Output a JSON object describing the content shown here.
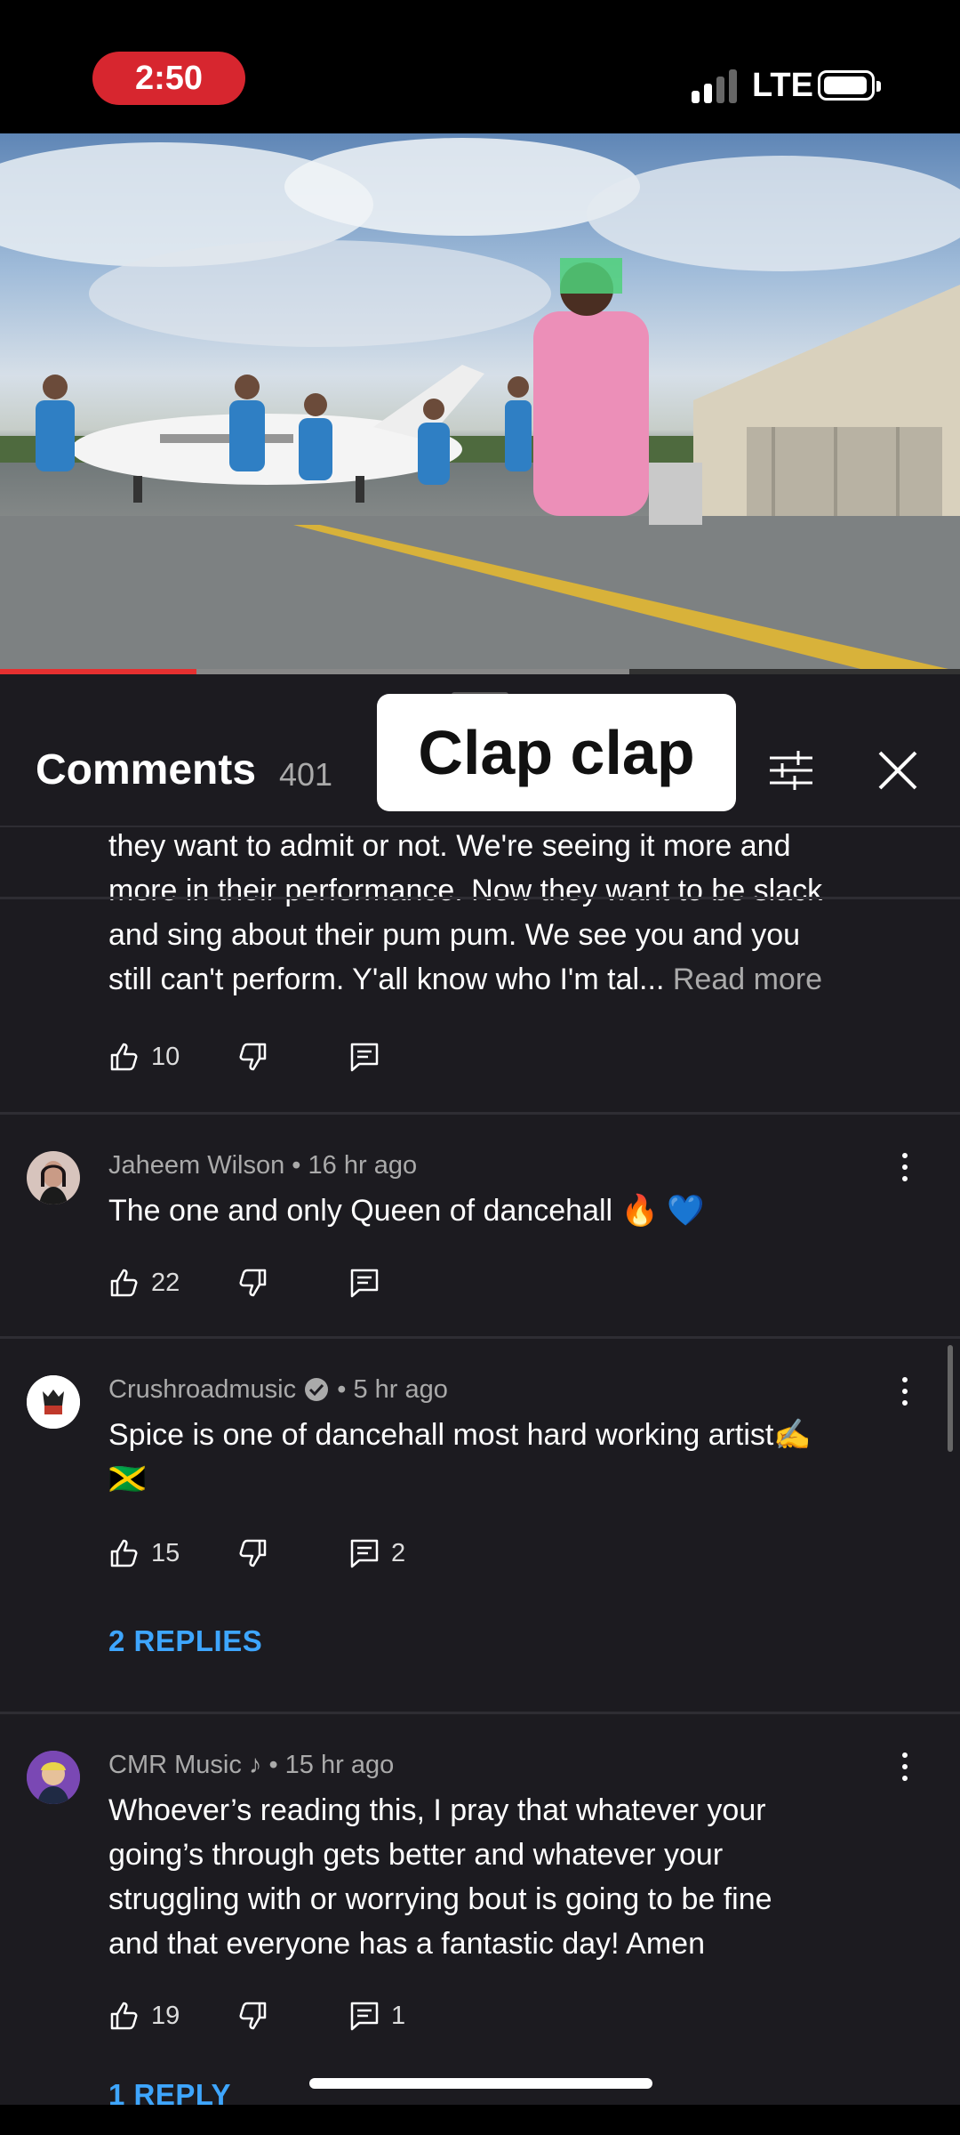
{
  "status": {
    "time": "2:50",
    "network": "LTE"
  },
  "video": {
    "played_fraction": 0.205,
    "buffered_fraction": 0.656
  },
  "panel": {
    "title": "Comments",
    "count": "401",
    "caption": "Clap clap"
  },
  "comments": [
    {
      "text_lines": [
        "they want to admit or not. We're seeing it more and",
        "more in their performance. Now they want to be slack",
        "and sing about their pum pum. We see you and you",
        "still can't perform. Y'all know who I'm tal..."
      ],
      "read_more": "Read more",
      "likes": "10"
    },
    {
      "author": "Jaheem Wilson",
      "age": "16 hr ago",
      "text": "The one and only Queen of dancehall 🔥 💙",
      "likes": "22"
    },
    {
      "author": "Crushroadmusic",
      "age": "5 hr ago",
      "text_line1": "Spice is one of dancehall most hard working artist✍️",
      "text_line2": "🇯🇲",
      "likes": "15",
      "reply_count": "2",
      "replies_label": "2 REPLIES"
    },
    {
      "author": "CMR Music ♪",
      "age": "15 hr ago",
      "text_lines": [
        "Whoever’s reading this, I pray that whatever your",
        "going’s through gets better and whatever your",
        "struggling with or worrying bout is going to be fine",
        "and that everyone has a fantastic day! Amen"
      ],
      "likes": "19",
      "reply_count": "1",
      "replies_label": "1 REPLY"
    }
  ],
  "icons": {
    "like": "thumbs-up-icon",
    "dislike": "thumbs-down-icon",
    "reply": "reply-comment-icon",
    "more": "more-vert-icon",
    "filter": "filter-sliders-icon",
    "close": "close-icon"
  },
  "colors": {
    "replies_link": "#3ea6ff",
    "time_pill": "#d7262f",
    "progress": "#e53030"
  }
}
